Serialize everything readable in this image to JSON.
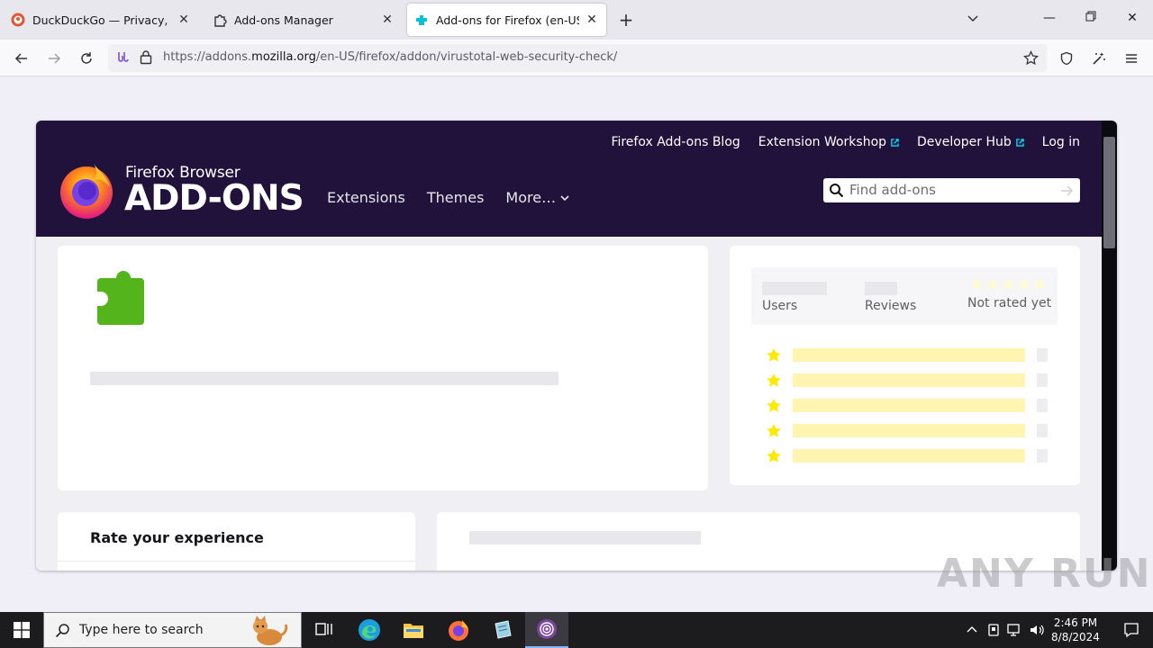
{
  "browser": {
    "tabs": [
      {
        "title": "DuckDuckGo — Privacy, simplified.",
        "active": false,
        "icon": "duckduckgo-icon"
      },
      {
        "title": "Add-ons Manager",
        "active": false,
        "icon": "puzzle-icon"
      },
      {
        "title": "Add-ons for Firefox (en-US)",
        "active": true,
        "icon": "addons-icon"
      }
    ],
    "url_prefix": "https://addons.",
    "url_domain": "mozilla.org",
    "url_path": "/en-US/firefox/addon/virustotal-web-security-check/"
  },
  "header": {
    "top_links": [
      "Firefox Add-ons Blog",
      "Extension Workshop",
      "Developer Hub",
      "Log in"
    ],
    "brand_line1": "Firefox Browser",
    "brand_line2": "ADD-ONS",
    "nav": [
      "Extensions",
      "Themes",
      "More…"
    ],
    "search_placeholder": "Find add-ons"
  },
  "stats": {
    "users_label": "Users",
    "reviews_label": "Reviews",
    "rating_text": "Not rated yet",
    "rating_rows": 5
  },
  "rate": {
    "heading": "Rate your experience"
  },
  "watermark": "ANY RUN",
  "taskbar": {
    "search_placeholder": "Type here to search",
    "time": "2:46 PM",
    "date": "8/8/2024"
  },
  "colors": {
    "header_bg": "#20123a",
    "addon_icon": "#54b41c",
    "star": "#ffe900",
    "link_icon": "#00ddff"
  }
}
